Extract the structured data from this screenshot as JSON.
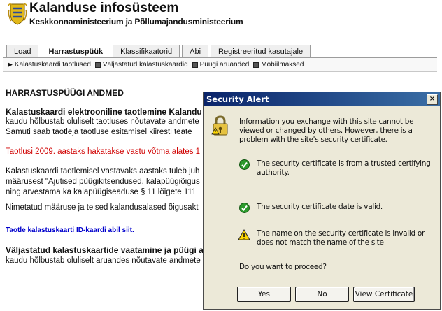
{
  "header": {
    "title": "Kalanduse infosüsteem",
    "subtitle": "Keskkonnaministeerium ja Põllumajandusministeerium"
  },
  "tabs": [
    {
      "label": "Load"
    },
    {
      "label": "Harrastuspüük"
    },
    {
      "label": "Klassifikaatorid"
    },
    {
      "label": "Abi"
    },
    {
      "label": "Registreeritud kasutajale"
    }
  ],
  "subnav": [
    {
      "label": "Kalastuskaardi taotlused"
    },
    {
      "label": "Väljastatud kalastuskaardid"
    },
    {
      "label": "Püügi aruanded"
    },
    {
      "label": "Mobiilmaksed"
    }
  ],
  "main": {
    "section_title": "HARRASTUSPÜÜGI ANDMED",
    "heading1": "Kalastuskaardi elektrooniline taotlemine Kalandu",
    "p1_line1": "kaudu hõlbustab oluliselt taotluses nõutavate andmete",
    "p1_line2": "Samuti saab taotleja taotluse esitamisel kiiresti teate",
    "red_notice": "Taotlusi 2009. aastaks hakatakse vastu võtma alates 1",
    "p2_line1": "Kalastuskaardi taotlemisel vastavaks aastaks tuleb juh",
    "p2_line2": "määrusest \"Ajutised püügikitsendused, kalapüügiõigus",
    "p2_line3": "ning arvestama ka kalapüügiseaduse § 11 lõigete 111",
    "p3": "Nimetatud määruse ja teised kalandusalased õigusakt",
    "link": "Taotle kalastuskaarti ID-kaardi abil siit.",
    "heading2": "Väljastatud kalastuskaartide vaatamine ja püügi a",
    "p4": "kaudu hõlbustab oluliselt aruandes nõutavate andmete"
  },
  "dialog": {
    "title": "Security Alert",
    "close": "×",
    "intro": "Information you exchange with this site cannot be viewed or changed by others. However, there is a problem with the site's security certificate.",
    "check1": "The security certificate is from a trusted certifying authority.",
    "check2": "The security certificate date is valid.",
    "warning": "The name on the security certificate is invalid or does not match the name of the site",
    "question": "Do you want to proceed?",
    "buttons": {
      "yes": "Yes",
      "no": "No",
      "view": "View Certificate"
    }
  }
}
